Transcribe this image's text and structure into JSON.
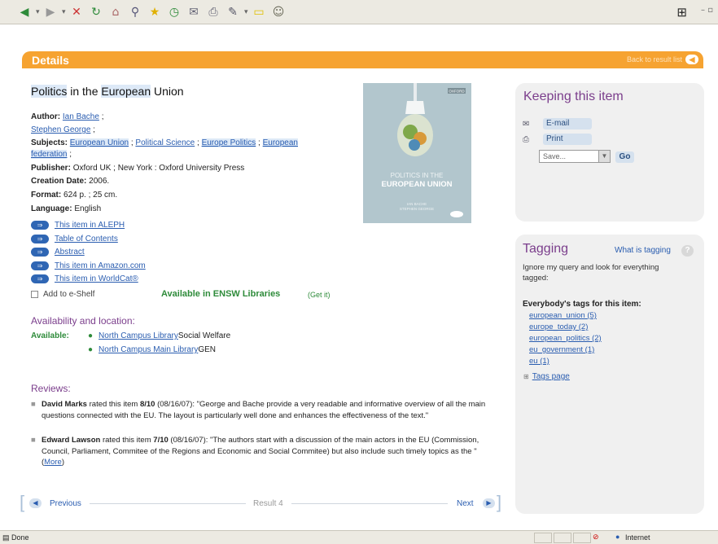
{
  "toolbar": {
    "buttons": [
      "back",
      "forward",
      "stop",
      "refresh",
      "home",
      "search",
      "favorites",
      "history",
      "mail",
      "print",
      "edit",
      "discuss",
      "messenger"
    ],
    "icons": {
      "back": "◀",
      "forward": "▶",
      "stop": "✕",
      "refresh": "↻",
      "home": "⌂",
      "search": "⚲",
      "favorites": "★",
      "history": "◷",
      "mail": "✉",
      "print": "⎙",
      "edit": "✎",
      "discuss": "▭",
      "messenger": "☺"
    }
  },
  "header": {
    "title": "Details",
    "back_link": "Back to result list"
  },
  "record": {
    "title_word1": "Politics",
    "title_mid": " in the ",
    "title_word2": "European",
    "title_end": " Union",
    "author_label": "Author:",
    "author1": "Ian Bache",
    "author2": "Stephen George",
    "subjects_label": "Subjects:",
    "subjects": [
      "European Union",
      "Political Science",
      "Europe Politics",
      "European federation"
    ],
    "publisher_label": "Publisher:",
    "publisher": "Oxford UK ; New York : Oxford University Press",
    "creation_label": "Creation Date:",
    "creation": "2006.",
    "format_label": "Format:",
    "format": "624 p. ; 25 cm.",
    "language_label": "Language:",
    "language": "English"
  },
  "cover": {
    "publisher": "OXFORD",
    "line1": "POLITICS IN THE",
    "line2": "EUROPEAN UNION",
    "authors": "IAN BACHE",
    "authors2": "STEPHEN GEORGE"
  },
  "links": [
    "This item in ALEPH",
    "Table of Contents",
    "Abstract",
    "This item in Amazon.com",
    "This item in WorldCat®"
  ],
  "eshelf": "Add to e-Shelf",
  "availability": {
    "summary": "Available in ENSW Libraries",
    "get_it": "(Get it)",
    "heading": "Availability and location:",
    "label": "Available:",
    "lib1_link": "North Campus Library",
    "lib1_loc": " Social Welfare",
    "lib2_link": "North Campus Main Library",
    "lib2_loc": " GEN"
  },
  "reviews": {
    "heading": "Reviews:",
    "r1_name": "David Marks",
    "r1_rated": " rated this item ",
    "r1_score": "8/10",
    "r1_text": " (08/16/07): \"George and Bache provide a very readable and informative overview of all the main questions connected with the EU. The layout is particularly well done and enhances the effectiveness of the text.\"",
    "r2_name": "Edward Lawson",
    "r2_rated": " rated this item ",
    "r2_score": "7/10",
    "r2_text": " (08/16/07): \"The authors start with a discussion of the main actors in the EU (Commission, Council, Parliament, Commitee of the Regions and Economic and Social Commitee) but also include such timely topics as the \" (",
    "r2_more": "More",
    "r2_close": ")"
  },
  "pager": {
    "previous": "Previous",
    "result": "Result 4",
    "next": "Next"
  },
  "keeping": {
    "title": "Keeping this item",
    "email": "E-mail",
    "print": "Print",
    "save_placeholder": "Save...",
    "go": "Go"
  },
  "tagging": {
    "title": "Tagging",
    "what": "What is tagging",
    "help": "?",
    "ignore": "Ignore my query and look for everything tagged:",
    "heading": "Everybody's tags for this item:",
    "tags": [
      "european_union (5)",
      "europe_today (2)",
      "european_politics (2)",
      "eu_government (1)",
      "eu (1)"
    ],
    "tags_page": "Tags page"
  },
  "statusbar": {
    "done": "Done",
    "zone": "Internet"
  },
  "colors": {
    "accent": "#f6a331",
    "heading": "#7b3e8c",
    "available": "#2e8b3a",
    "link": "#2a5db0"
  }
}
